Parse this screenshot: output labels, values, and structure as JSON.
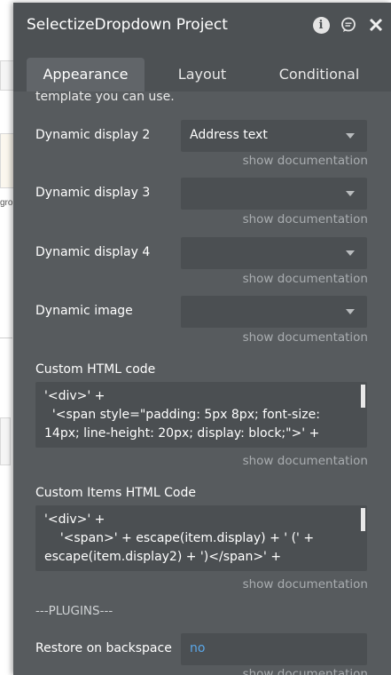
{
  "editor_bg": {
    "left_text": "gro",
    "right_mark": "I"
  },
  "panel": {
    "title": "SelectizeDropdown Project",
    "tabs": [
      {
        "label": "Appearance",
        "active": true
      },
      {
        "label": "Layout",
        "active": false
      },
      {
        "label": "Conditional",
        "active": false
      }
    ],
    "intro": "template you can use.",
    "fields": [
      {
        "label": "Dynamic display 2",
        "value": "Address text",
        "doc": "show documentation"
      },
      {
        "label": "Dynamic display 3",
        "value": "",
        "doc": "show documentation"
      },
      {
        "label": "Dynamic display 4",
        "value": "",
        "doc": "show documentation"
      },
      {
        "label": "Dynamic image",
        "value": "",
        "doc": "show documentation"
      }
    ],
    "custom_html": {
      "label": "Custom HTML code",
      "code": "'<div>' +\n  '<span style=\"padding: 5px 8px; font-size: 14px; line-height: 20px; display: block;\">' +",
      "doc": "show documentation"
    },
    "custom_items_html": {
      "label": "Custom Items HTML Code",
      "code": "'<div>' +\n    '<span>' + escape(item.display) + ' (' + escape(item.display2) + ')</span>' +",
      "doc": "show documentation"
    },
    "plugins_header": "---PLUGINS---",
    "restore_on_backspace": {
      "label": "Restore on backspace",
      "value": "no",
      "doc": "show documentation"
    }
  },
  "colors": {
    "panel_bg": "#575b5e",
    "header_bg": "#4d5154",
    "field_bg": "#4b4f52",
    "link_blue": "#5aa7e8"
  }
}
